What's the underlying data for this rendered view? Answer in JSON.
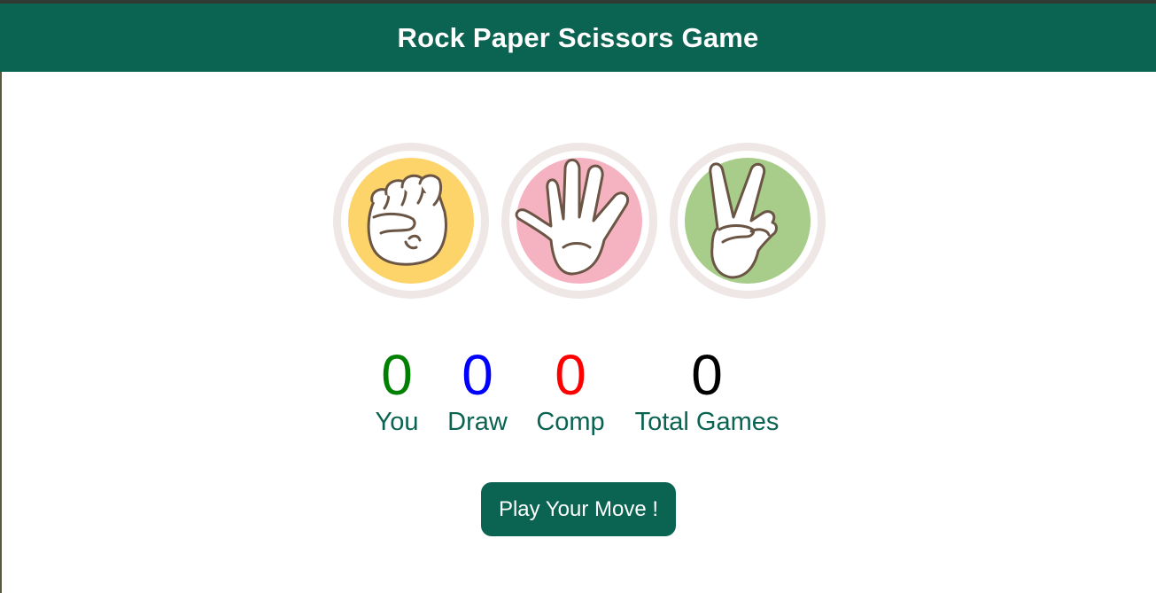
{
  "header": {
    "title": "Rock Paper Scissors Game"
  },
  "choices": [
    {
      "id": "rock",
      "icon": "rock-hand-icon",
      "color": "#fcd46a"
    },
    {
      "id": "paper",
      "icon": "paper-hand-icon",
      "color": "#f5b3c2"
    },
    {
      "id": "scissors",
      "icon": "scissors-hand-icon",
      "color": "#a8cd8a"
    }
  ],
  "scores": {
    "you": {
      "value": "0",
      "label": "You",
      "color": "#008000"
    },
    "draw": {
      "value": "0",
      "label": "Draw",
      "color": "#0000ff"
    },
    "comp": {
      "value": "0",
      "label": "Comp",
      "color": "#ff0000"
    },
    "total": {
      "value": "0",
      "label": "Total Games",
      "color": "#000000"
    }
  },
  "play_button": {
    "label": "Play Your Move !"
  },
  "colors": {
    "brand": "#0b6351",
    "ring": "#efe6e6",
    "hand_fill": "#ffffff",
    "hand_stroke": "#6b5544"
  }
}
